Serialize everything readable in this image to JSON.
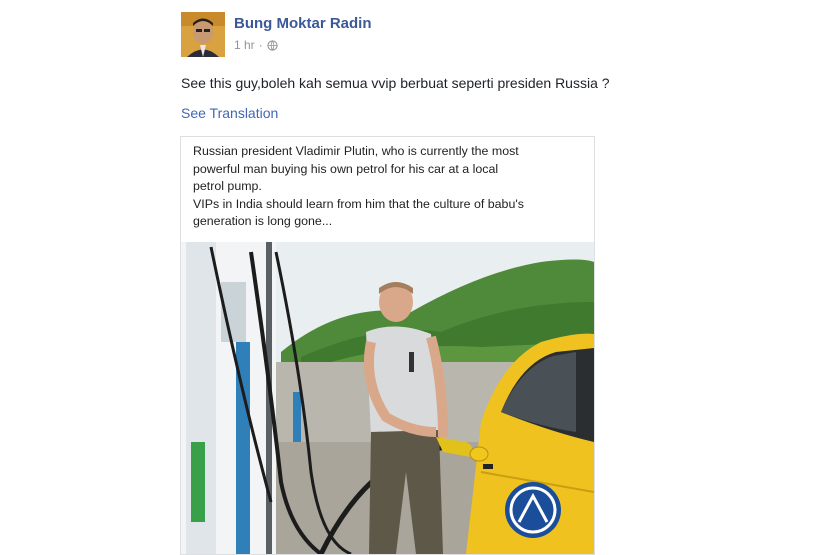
{
  "post": {
    "author": "Bung Moktar Radin",
    "time": "1 hr",
    "separator": "·",
    "privacy_icon": "globe-icon",
    "text": "See this guy,boleh kah semua vvip berbuat seperti presiden Russia ?",
    "see_translation": "See Translation"
  },
  "shared_image": {
    "caption_lines": [
      "Russian president Vladimir Plutin, who is currently the most",
      "powerful man buying his own petrol for his car at a local",
      "petrol pump.",
      "VIPs in India should learn from him that the culture of babu's",
      "generation is long gone..."
    ]
  },
  "colors": {
    "link": "#3b5998",
    "meta": "#90949c",
    "text": "#1d2129"
  }
}
